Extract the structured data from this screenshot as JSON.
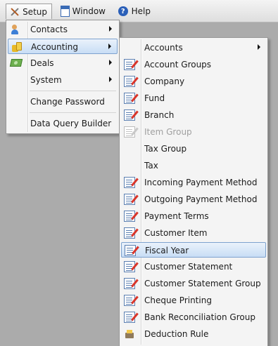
{
  "menubar": {
    "items": [
      {
        "label": "Setup",
        "icon": "tools-icon"
      },
      {
        "label": "Window",
        "icon": "window-icon"
      },
      {
        "label": "Help",
        "icon": "help-icon"
      }
    ]
  },
  "setup_menu": {
    "items": [
      {
        "label": "Contacts",
        "icon": "contacts-icon",
        "submenu": true
      },
      {
        "label": "Accounting",
        "icon": "accounting-icon",
        "submenu": true,
        "highlighted": true
      },
      {
        "label": "Deals",
        "icon": "deals-icon",
        "submenu": true
      },
      {
        "label": "System",
        "submenu": true
      },
      {
        "label": "Change Password"
      },
      {
        "label": "Data Query Builder"
      }
    ]
  },
  "accounting_menu": {
    "items": [
      {
        "label": "Accounts",
        "submenu": true
      },
      {
        "label": "Account Groups",
        "icon": "form-edit-icon"
      },
      {
        "label": "Company",
        "icon": "form-edit-icon"
      },
      {
        "label": "Fund",
        "icon": "form-edit-icon"
      },
      {
        "label": "Branch",
        "icon": "form-edit-icon"
      },
      {
        "label": "Item Group",
        "icon": "form-edit-icon",
        "disabled": true
      },
      {
        "label": "Tax Group"
      },
      {
        "label": "Tax"
      },
      {
        "label": "Incoming Payment Method",
        "icon": "form-edit-icon"
      },
      {
        "label": "Outgoing Payment Method",
        "icon": "form-edit-icon"
      },
      {
        "label": "Payment Terms",
        "icon": "form-edit-icon"
      },
      {
        "label": "Customer Item",
        "icon": "form-edit-icon"
      },
      {
        "label": "Fiscal Year",
        "icon": "form-edit-icon",
        "highlighted": true
      },
      {
        "label": "Customer Statement",
        "icon": "form-edit-icon"
      },
      {
        "label": "Customer Statement Group",
        "icon": "form-edit-icon"
      },
      {
        "label": "Cheque Printing",
        "icon": "form-edit-icon"
      },
      {
        "label": "Bank Reconciliation Group",
        "icon": "form-edit-icon"
      },
      {
        "label": "Deduction Rule",
        "icon": "deduction-icon"
      }
    ]
  },
  "colors": {
    "background": "#ababab",
    "highlight_border": "#7da2ce",
    "highlight_fill": "#c8ddf5"
  }
}
